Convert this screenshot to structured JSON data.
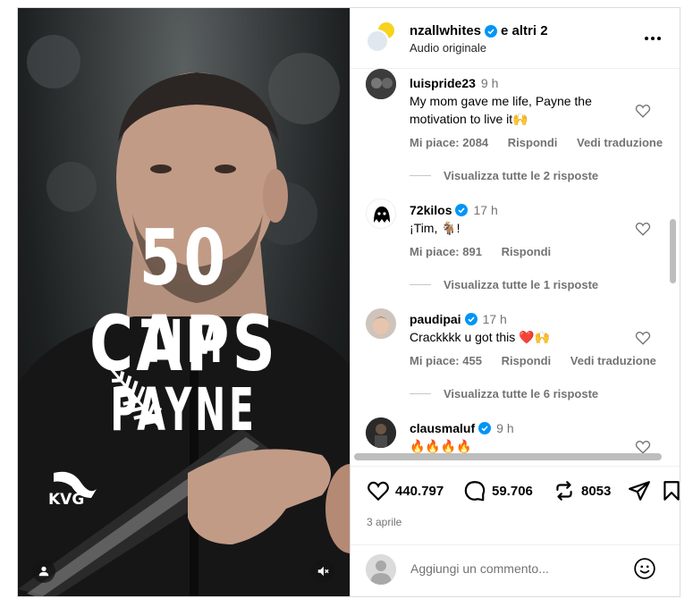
{
  "media": {
    "line1": "50 CAPS",
    "line2": "TIM PAYNE",
    "jersey_text": "KVG",
    "user_icon": "user-icon",
    "mute_icon": "speaker-muted-icon"
  },
  "header": {
    "username": "nzallwhites",
    "others": "e altri 2",
    "subtitle": "Audio originale",
    "more_icon": "more-horizontal-icon"
  },
  "comments": [
    {
      "user": "luispride23",
      "verified": false,
      "time": "9 h",
      "text": "My mom gave me life, Payne the motivation to live it🙌",
      "likes": "Mi piace: 2084",
      "reply": "Rispondi",
      "translate": "Vedi traduzione",
      "replies": "Visualizza tutte le 2 risposte"
    },
    {
      "user": "72kilos",
      "verified": true,
      "time": "17 h",
      "text": "¡Tim, 🐐!",
      "likes": "Mi piace: 891",
      "reply": "Rispondi",
      "translate": "",
      "replies": "Visualizza tutte le 1 risposte"
    },
    {
      "user": "paudipai",
      "verified": true,
      "time": "17 h",
      "text": "Crackkkk u got this ❤️🙌",
      "likes": "Mi piace: 455",
      "reply": "Rispondi",
      "translate": "Vedi traduzione",
      "replies": "Visualizza tutte le 6 risposte"
    },
    {
      "user": "clausmaluf",
      "verified": true,
      "time": "9 h",
      "text": "🔥🔥🔥🔥",
      "likes": "",
      "reply": "",
      "translate": "",
      "replies": ""
    }
  ],
  "actions": {
    "likes": "440.797",
    "comments": "59.706",
    "reposts": "8053",
    "date": "3 aprile"
  },
  "compose": {
    "placeholder": "Aggiungi un commento..."
  },
  "colors": {
    "verified": "#0095f6",
    "muted_text": "#737373",
    "border": "#dbdbdb"
  }
}
